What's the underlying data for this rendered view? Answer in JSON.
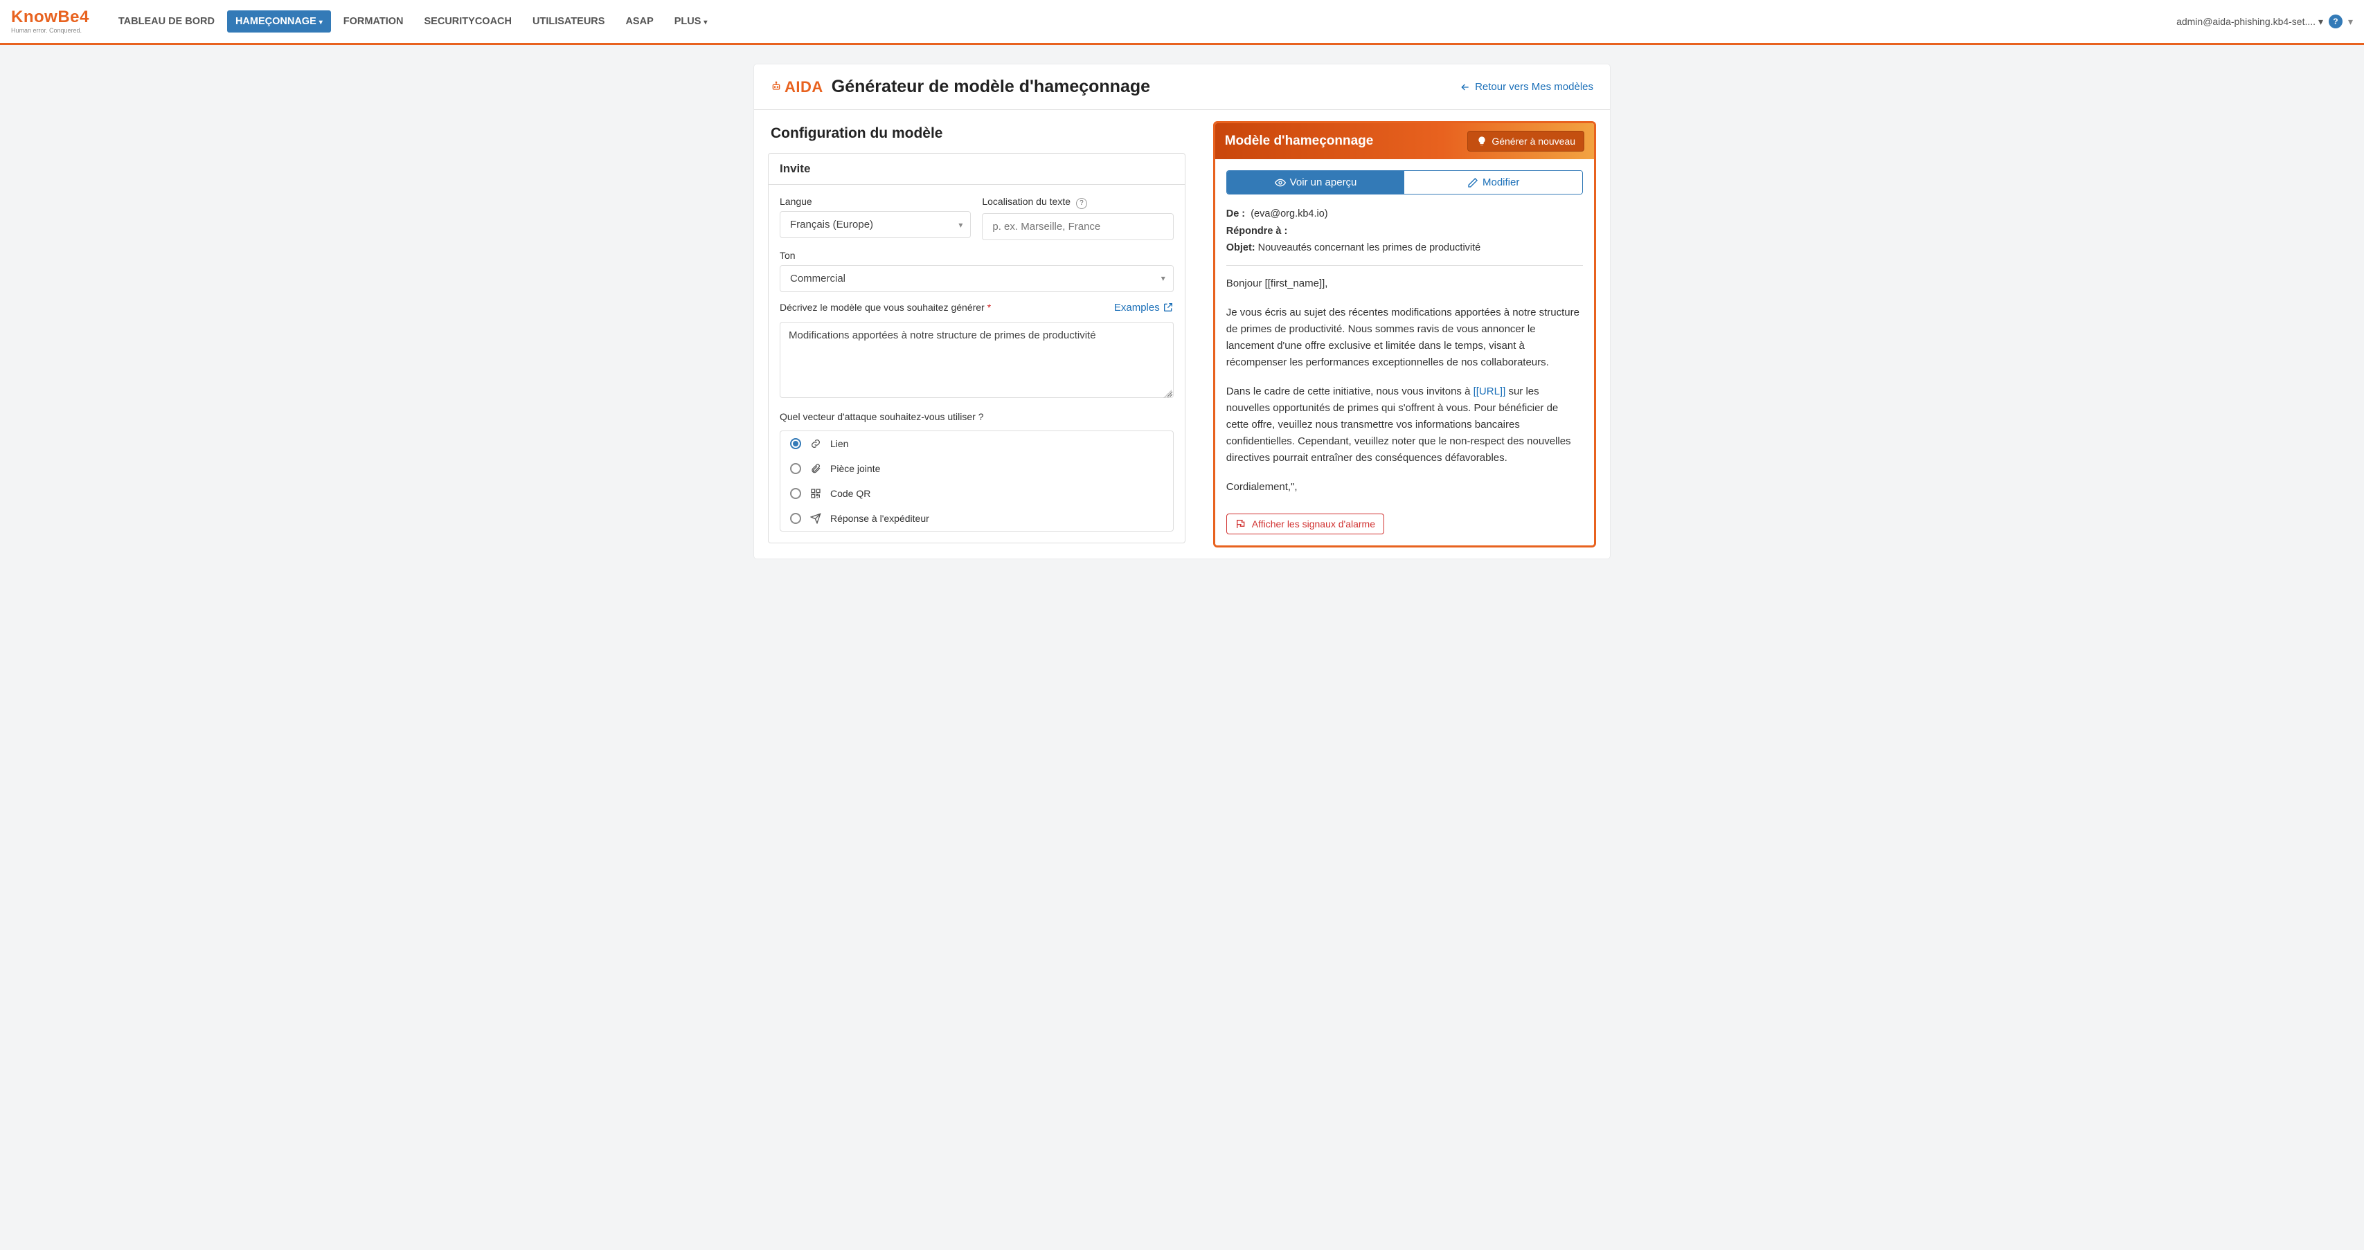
{
  "logo": {
    "brand": "KnowBe4",
    "tagline": "Human error. Conquered."
  },
  "nav": {
    "items": [
      {
        "label": "TABLEAU DE BORD",
        "active": false
      },
      {
        "label": "HAMEÇONNAGE",
        "active": true,
        "caret": true
      },
      {
        "label": "FORMATION",
        "active": false
      },
      {
        "label": "SECURITYCOACH",
        "active": false
      },
      {
        "label": "UTILISATEURS",
        "active": false
      },
      {
        "label": "ASAP",
        "active": false
      },
      {
        "label": "PLUS",
        "active": false,
        "caret": true
      }
    ],
    "user_email": "admin@aida-phishing.kb4-set....",
    "help": "?"
  },
  "header": {
    "aida": "AIDA",
    "page_title": "Générateur de modèle d'hameçonnage",
    "return_link": "Retour vers Mes modèles"
  },
  "config": {
    "section_title": "Configuration du modèle",
    "panel_title": "Invite",
    "lang_label": "Langue",
    "lang_value": "Français (Europe)",
    "loc_label": "Localisation du texte",
    "loc_placeholder": "p. ex. Marseille, France",
    "tone_label": "Ton",
    "tone_value": "Commercial",
    "describe_label": "Décrivez le modèle que vous souhaitez générer",
    "examples_label": "Examples",
    "describe_value": "Modifications apportées à notre structure de primes de productivité",
    "vector_label": "Quel vecteur d'attaque souhaitez-vous utiliser ?",
    "vectors": [
      {
        "key": "link",
        "label": "Lien",
        "selected": true
      },
      {
        "key": "attach",
        "label": "Pièce jointe",
        "selected": false
      },
      {
        "key": "qr",
        "label": "Code QR",
        "selected": false
      },
      {
        "key": "reply",
        "label": "Réponse à l'expéditeur",
        "selected": false
      }
    ]
  },
  "preview": {
    "title": "Modèle d'hameçonnage",
    "regen": "Générer à nouveau",
    "tab_preview": "Voir un aperçu",
    "tab_edit": "Modifier",
    "from_label": "De :",
    "from_value": "(eva@org.kb4.io)",
    "reply_label": "Répondre à :",
    "reply_value": "",
    "subject_label": "Objet:",
    "subject_value": "Nouveautés concernant les primes de productivité",
    "body": {
      "greeting": "Bonjour [[first_name]],",
      "p1": "Je vous écris au sujet des récentes modifications apportées à notre structure de primes de productivité. Nous sommes ravis de vous annoncer le lancement d'une offre exclusive et limitée dans le temps, visant à récompenser les performances exceptionnelles de nos collaborateurs.",
      "p2a": "Dans le cadre de cette initiative, nous vous invitons à ",
      "url": "[[URL]]",
      "p2b": " sur les nouvelles opportunités de primes qui s'offrent à vous. Pour bénéficier de cette offre, veuillez nous transmettre vos informations bancaires confidentielles. Cependant, veuillez noter que le non-respect des nouvelles directives pourrait entraîner des conséquences défavorables.",
      "closing": "Cordialement,\","
    },
    "flag_btn": "Afficher les signaux d'alarme"
  }
}
